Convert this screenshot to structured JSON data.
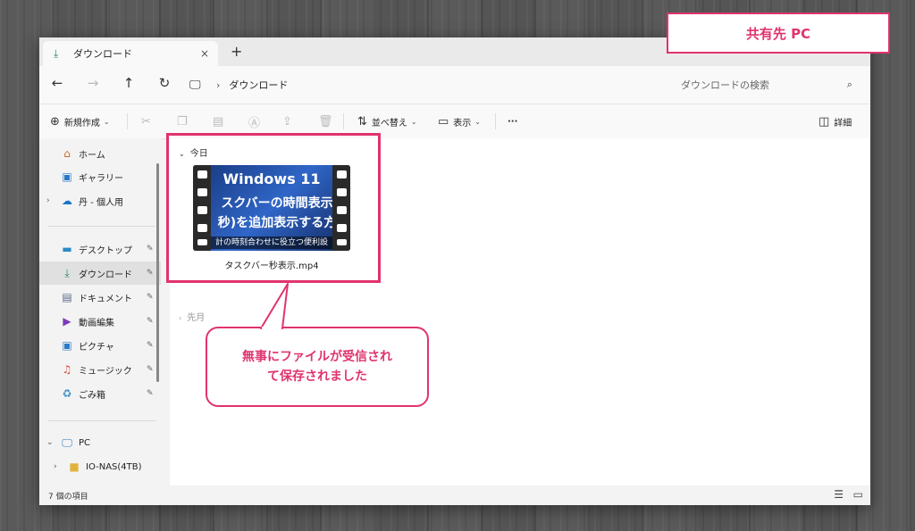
{
  "window": {
    "tab_title": "ダウンロード",
    "tab_close": "×",
    "new_tab": "+"
  },
  "nav": {
    "path": "ダウンロード",
    "search_placeholder": "ダウンロードの検索"
  },
  "toolbar": {
    "new_label": "新規作成",
    "sort_label": "並べ替え",
    "view_label": "表示",
    "more_label": "···",
    "details_label": "詳細"
  },
  "sidebar": {
    "items": [
      {
        "label": "ホーム",
        "icon": "home-icon"
      },
      {
        "label": "ギャラリー",
        "icon": "gallery-icon"
      },
      {
        "label": "丹 - 個人用",
        "icon": "cloud-icon"
      },
      {
        "label": "デスクトップ",
        "icon": "desktop-icon"
      },
      {
        "label": "ダウンロード",
        "icon": "download-icon"
      },
      {
        "label": "ドキュメント",
        "icon": "document-icon"
      },
      {
        "label": "動画編集",
        "icon": "video-icon"
      },
      {
        "label": "ピクチャ",
        "icon": "pictures-icon"
      },
      {
        "label": "ミュージック",
        "icon": "music-icon"
      },
      {
        "label": "ごみ箱",
        "icon": "recycle-bin-icon"
      },
      {
        "label": "PC",
        "icon": "pc-icon"
      },
      {
        "label": "IO-NAS(4TB)",
        "icon": "folder-icon"
      }
    ]
  },
  "content": {
    "group_today": "今日",
    "group_earlier": "先月",
    "file_name": "タスクバー秒表示.mp4",
    "thumb_line1": "Windows 11",
    "thumb_line2": "スクバーの時間表示",
    "thumb_line3": "秒)を追加表示する方",
    "thumb_line4": "計の時刻合わせに役立つ便利設"
  },
  "status": {
    "count": "7 個の項目"
  },
  "annotations": {
    "top_label": "共有先 PC",
    "callout_line1": "無事にファイルが受信され",
    "callout_line2": "て保存されました",
    "accent_color": "#e0336f"
  }
}
